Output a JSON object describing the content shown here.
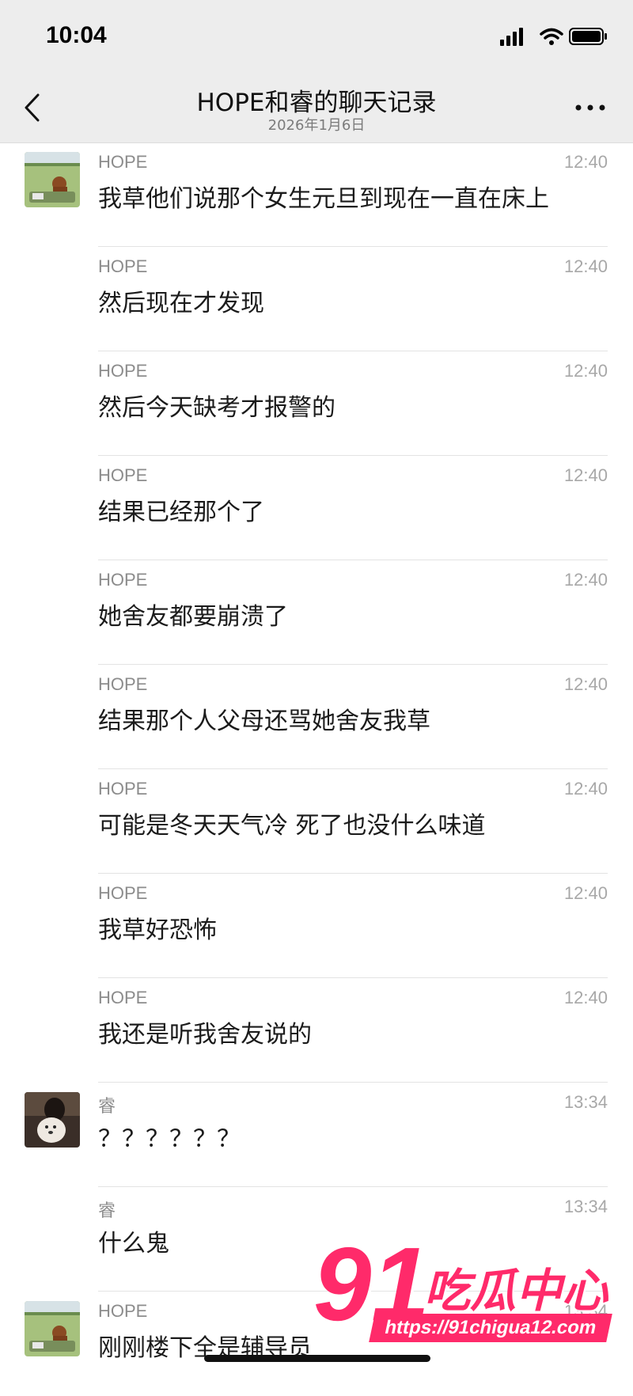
{
  "status_bar": {
    "time": "10:04",
    "icons": [
      "signal-icon",
      "wifi-icon",
      "battery-icon"
    ]
  },
  "header": {
    "title": "HOPE和睿的聊天记录",
    "subtitle": "2026年1月6日",
    "back_icon": "chevron-left-icon",
    "more_icon": "more-dots-icon"
  },
  "messages": [
    {
      "sender": "HOPE",
      "time": "12:40",
      "text": "我草他们说那个女生元旦到现在一直在床上"
    },
    {
      "sender": "HOPE",
      "time": "12:40",
      "text": "然后现在才发现"
    },
    {
      "sender": "HOPE",
      "time": "12:40",
      "text": "然后今天缺考才报警的"
    },
    {
      "sender": "HOPE",
      "time": "12:40",
      "text": "结果已经那个了"
    },
    {
      "sender": "HOPE",
      "time": "12:40",
      "text": "她舍友都要崩溃了"
    },
    {
      "sender": "HOPE",
      "time": "12:40",
      "text": "结果那个人父母还骂她舍友我草"
    },
    {
      "sender": "HOPE",
      "time": "12:40",
      "text": "可能是冬天天气冷 死了也没什么味道"
    },
    {
      "sender": "HOPE",
      "time": "12:40",
      "text": "我草好恐怖"
    },
    {
      "sender": "HOPE",
      "time": "12:40",
      "text": "我还是听我舍友说的"
    },
    {
      "sender": "睿",
      "time": "13:34",
      "text": "？？？？？？"
    },
    {
      "sender": "睿",
      "time": "13:34",
      "text": "什么鬼"
    },
    {
      "sender": "HOPE",
      "time": "13:34",
      "text": "刚刚楼下全是辅导员"
    }
  ],
  "watermark": {
    "number": "91",
    "name": "吃瓜中心",
    "url": "https://91chigua12.com"
  },
  "colors": {
    "header_bg": "#ededed",
    "watermark": "#ff2a6a"
  }
}
